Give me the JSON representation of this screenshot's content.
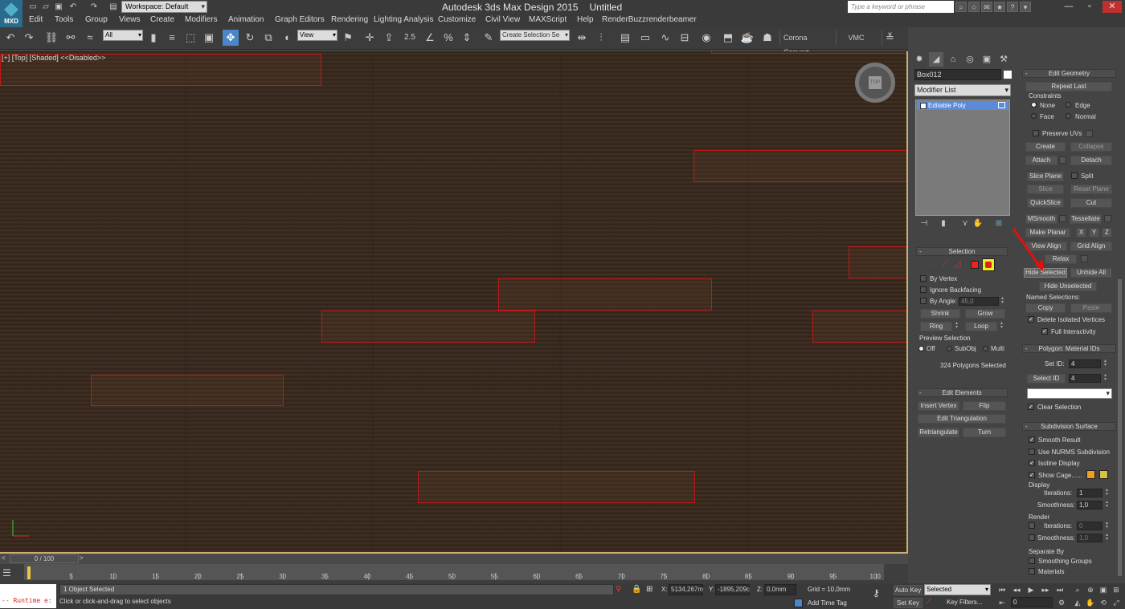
{
  "app": {
    "logo": "MXD",
    "title": "Autodesk 3ds Max Design 2015",
    "document": "Untitled",
    "workspace": "Workspace: Default",
    "search_placeholder": "Type a keyword or phrase"
  },
  "menu": [
    "Edit",
    "Tools",
    "Group",
    "Views",
    "Create",
    "Modifiers",
    "Animation",
    "Graph Editors",
    "Rendering",
    "Lighting Analysis",
    "Customize",
    "Civil View",
    "MAXScript",
    "Help",
    "RenderBuzz",
    "renderbeamer"
  ],
  "toolbar": {
    "selection_filter": "All",
    "ref_coord": "View",
    "snap_label": "2.5",
    "named_sel_placeholder": "Create Selection Se",
    "corona_convert": "Corona Convert",
    "vmc": "VMC"
  },
  "viewport": {
    "label": "[+] [Top] [Shaded]  <<Disabled>>",
    "viewcube_face": "TOP"
  },
  "command_panel": {
    "object_name": "Box012",
    "modifier_list": "Modifier List",
    "stack_items": [
      "Editable Poly"
    ],
    "selection": {
      "title": "Selection",
      "by_vertex": "By Vertex",
      "ignore_backfacing": "Ignore Backfacing",
      "by_angle": "By Angle:",
      "angle_value": "45,0",
      "shrink": "Shrink",
      "grow": "Grow",
      "ring": "Ring",
      "loop": "Loop",
      "preview_selection": "Preview Selection",
      "off": "Off",
      "subobj": "SubObj",
      "multi": "Multi",
      "status": "324 Polygons Selected"
    },
    "edit_elements": {
      "title": "Edit Elements",
      "insert_vertex": "Insert Vertex",
      "flip": "Flip",
      "edit_triangulation": "Edit Triangulation",
      "retriangulate": "Retriangulate",
      "turn": "Turn"
    },
    "edit_geometry": {
      "title": "Edit Geometry",
      "repeat_last": "Repeat Last",
      "constraints": "Constraints",
      "none": "None",
      "edge": "Edge",
      "face": "Face",
      "normal": "Normal",
      "preserve_uvs": "Preserve UVs",
      "create": "Create",
      "collapse": "Collapse",
      "attach": "Attach",
      "detach": "Detach",
      "slice_plane": "Slice Plane",
      "split": "Split",
      "slice": "Slice",
      "reset_plane": "Reset Plane",
      "quickslice": "QuickSlice",
      "cut": "Cut",
      "msmooth": "MSmooth",
      "tessellate": "Tessellate",
      "make_planar": "Make Planar",
      "x": "X",
      "y": "Y",
      "z": "Z",
      "view_align": "View Align",
      "grid_align": "Grid Align",
      "relax": "Relax",
      "hide_selected": "Hide Selected",
      "unhide_all": "Unhide All",
      "hide_unselected": "Hide Unselected",
      "named_selections": "Named Selections:",
      "copy": "Copy",
      "paste": "Paste",
      "delete_isolated": "Delete Isolated Vertices",
      "full_interactivity": "Full Interactivity"
    },
    "material_ids": {
      "title": "Polygon: Material IDs",
      "set_id": "Set ID:",
      "set_id_value": "4",
      "select_id": "Select ID",
      "select_id_value": "4",
      "clear_selection": "Clear Selection"
    },
    "subdivision": {
      "title": "Subdivision Surface",
      "smooth_result": "Smooth Result",
      "use_nurms": "Use NURMS Subdivision",
      "isoline_display": "Isoline Display",
      "show_cage": "Show Cage......",
      "display": "Display",
      "iterations": "Iterations:",
      "iterations_value": "1",
      "smoothness": "Smoothness:",
      "smoothness_value": "1,0",
      "render": "Render",
      "render_iterations_value": "0",
      "render_smoothness_value": "1,0",
      "separate_by": "Separate By",
      "smoothing_groups": "Smoothing Groups",
      "materials": "Materials",
      "cage_color_1": "#f0a020",
      "cage_color_2": "#d8c040"
    }
  },
  "timeline": {
    "frame_display": "0 / 100",
    "ticks": [
      "5",
      "10",
      "15",
      "20",
      "25",
      "30",
      "35",
      "40",
      "45",
      "50",
      "55",
      "60",
      "65",
      "70",
      "75",
      "80",
      "85",
      "90",
      "95",
      "100"
    ]
  },
  "status": {
    "maxscript": "-- Runtime e:",
    "objects_selected": "1 Object Selected",
    "prompt": "Click or click-and-drag to select objects",
    "x_label": "X:",
    "x_value": "5134,267m",
    "y_label": "Y:",
    "y_value": "-1895,209c",
    "z_label": "Z:",
    "z_value": "0,0mm",
    "grid": "Grid = 10,0mm",
    "add_time_tag": "Add Time Tag",
    "auto_key": "Auto Key",
    "set_key": "Set Key",
    "key_mode": "Selected",
    "key_filters": "Key Filters...",
    "current_frame": "0"
  }
}
